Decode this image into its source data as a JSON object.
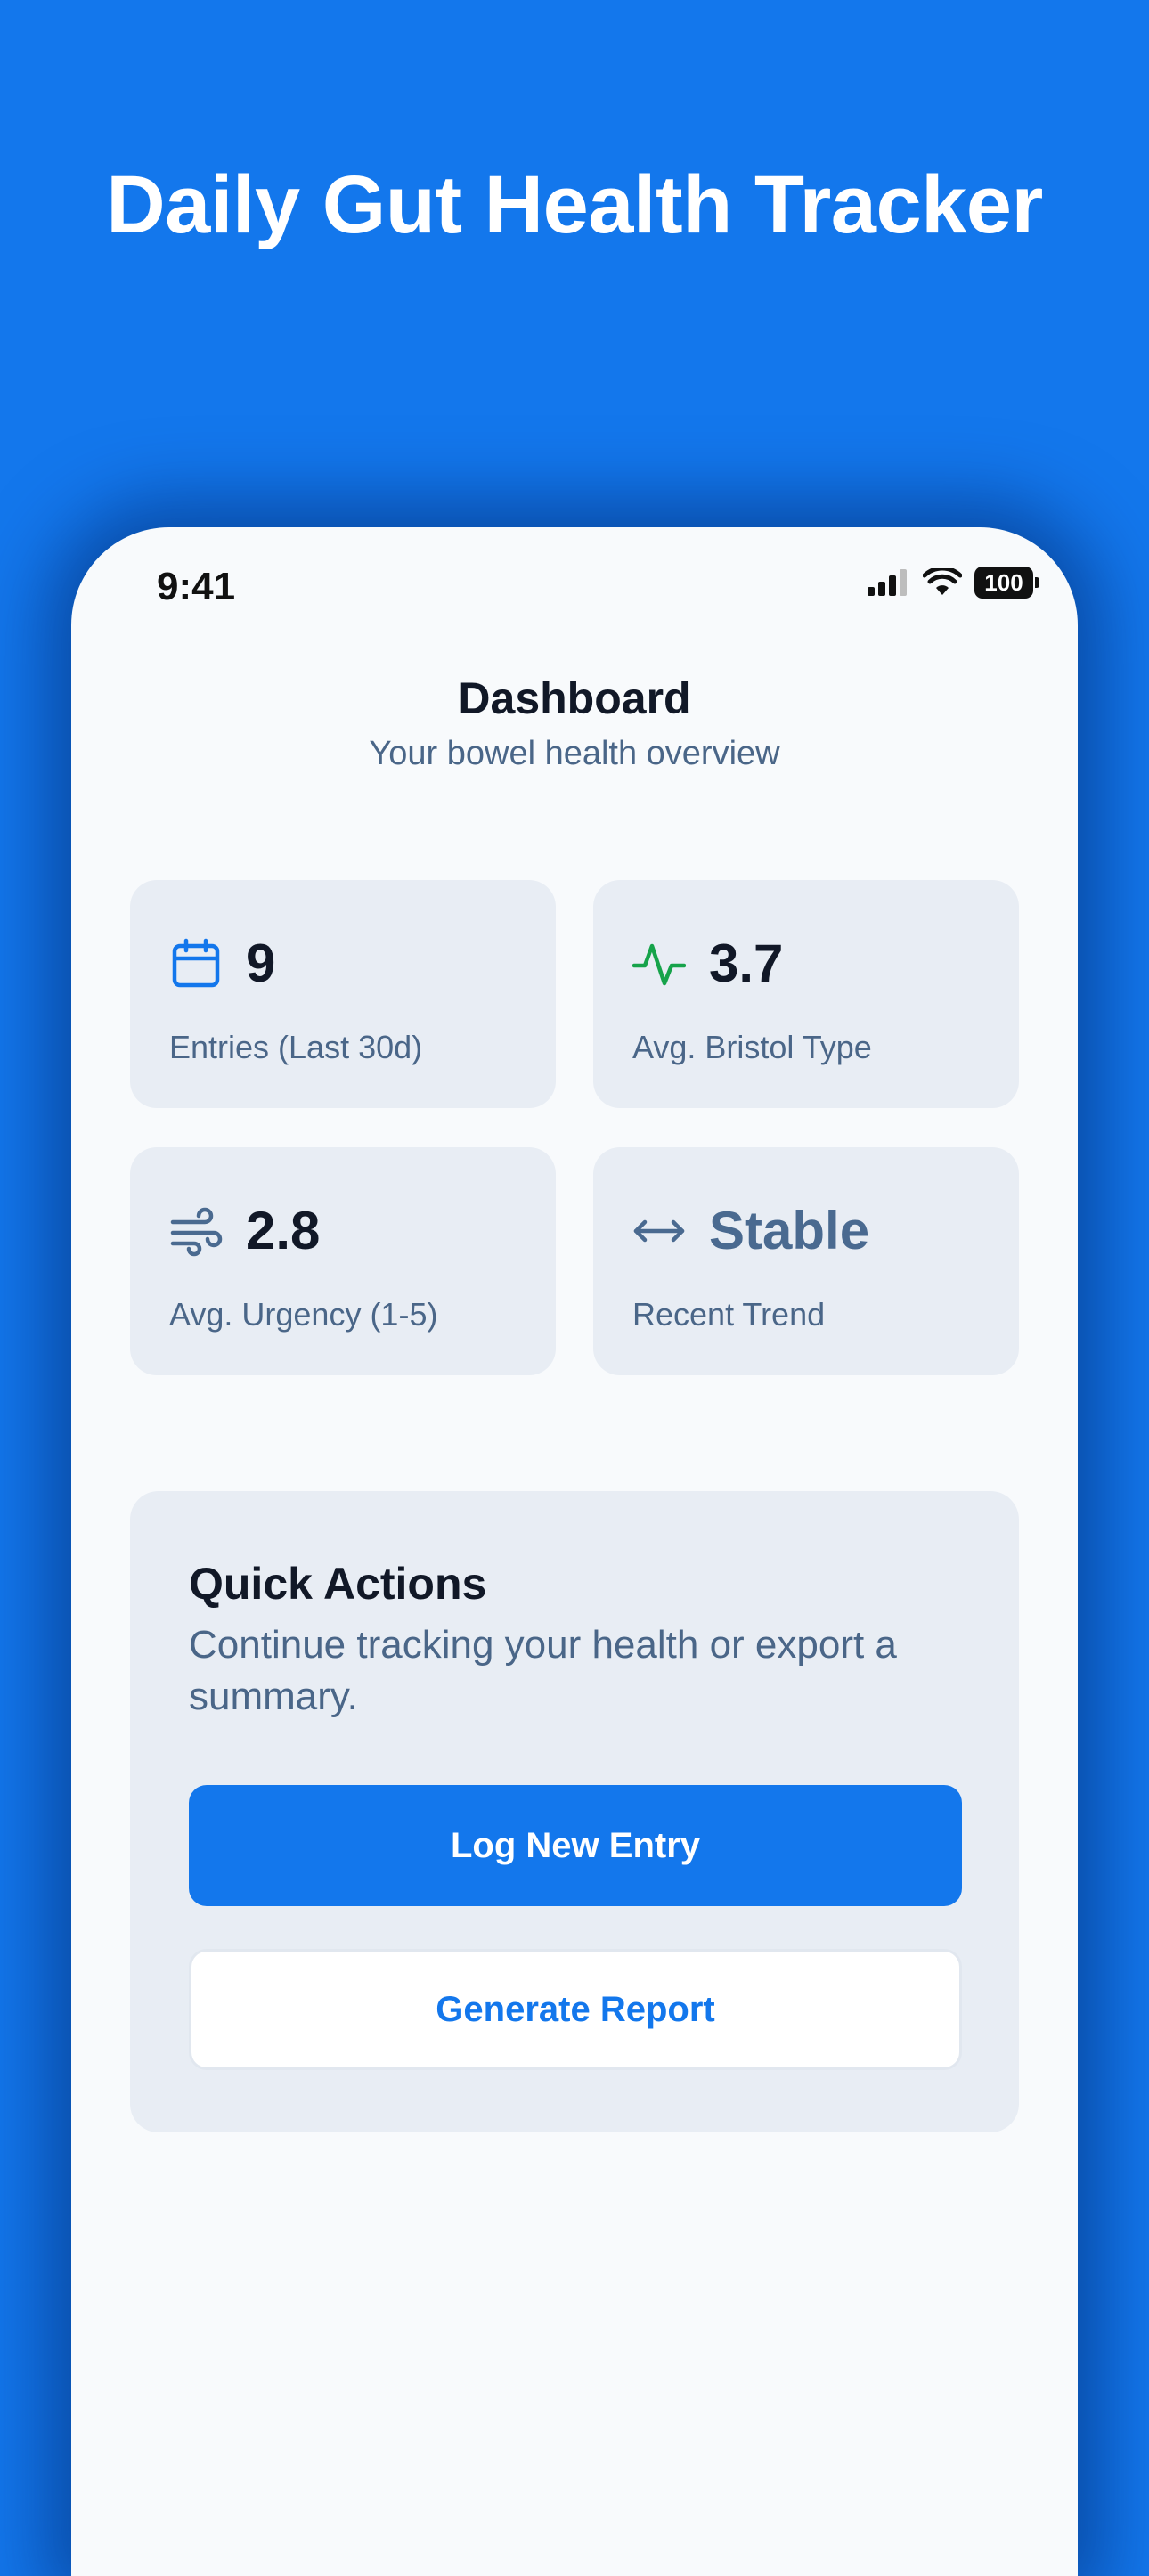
{
  "hero_title": "Daily Gut Health Tracker",
  "status_bar": {
    "time": "9:41",
    "battery": "100"
  },
  "header": {
    "title": "Dashboard",
    "subtitle": "Your bowel health overview"
  },
  "stats": [
    {
      "icon": "calendar-icon",
      "value": "9",
      "label": "Entries (Last 30d)",
      "icon_color": "#1377EC"
    },
    {
      "icon": "activity-pulse-icon",
      "value": "3.7",
      "label": "Avg. Bristol Type",
      "icon_color": "#16A34A"
    },
    {
      "icon": "wind-icon",
      "value": "2.8",
      "label": "Avg. Urgency (1-5)",
      "icon_color": "#4A6A90"
    },
    {
      "icon": "arrows-horizontal-icon",
      "value": "Stable",
      "label": "Recent Trend",
      "icon_color": "#4A6A90"
    }
  ],
  "quick_actions": {
    "title": "Quick Actions",
    "description": "Continue tracking your health or export a summary.",
    "primary_button": "Log New Entry",
    "secondary_button": "Generate Report"
  },
  "colors": {
    "background": "#1377EC",
    "accent": "#1377EC",
    "card": "#E8EDF4",
    "text_primary": "#111827",
    "text_secondary": "#4A6688"
  }
}
